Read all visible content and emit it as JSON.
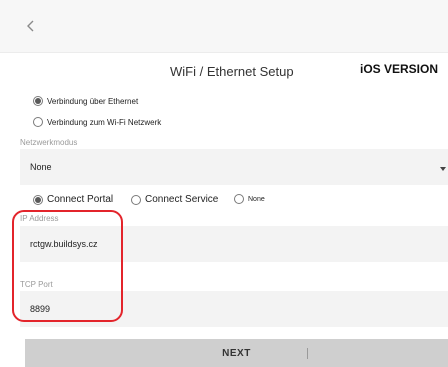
{
  "screen": {
    "title": "WiFi / Ethernet Setup",
    "platform_label": "iOS VERSION",
    "back_icon": "chevron-left-icon"
  },
  "connection_mode": {
    "options": [
      {
        "label": "Verbindung über Ethernet",
        "selected": true
      },
      {
        "label": "Verbindung zum Wi-Fi Netzwerk",
        "selected": false
      }
    ]
  },
  "network_mode": {
    "label": "Netzwerkmodus",
    "value": "None"
  },
  "portal_mode": {
    "options": [
      {
        "label": "Connect Portal",
        "selected": true
      },
      {
        "label": "Connect Service",
        "selected": false
      },
      {
        "label": "None",
        "selected": false
      }
    ]
  },
  "ip_address": {
    "label": "IP Address",
    "value": "rctgw.buildsys.cz"
  },
  "tcp_port": {
    "label": "TCP Port",
    "value": "8899"
  },
  "actions": {
    "next_label": "NEXT"
  },
  "colors": {
    "highlight": "#e3242b",
    "button_bg": "#cfcfcf",
    "field_bg": "#f3f3f3"
  }
}
